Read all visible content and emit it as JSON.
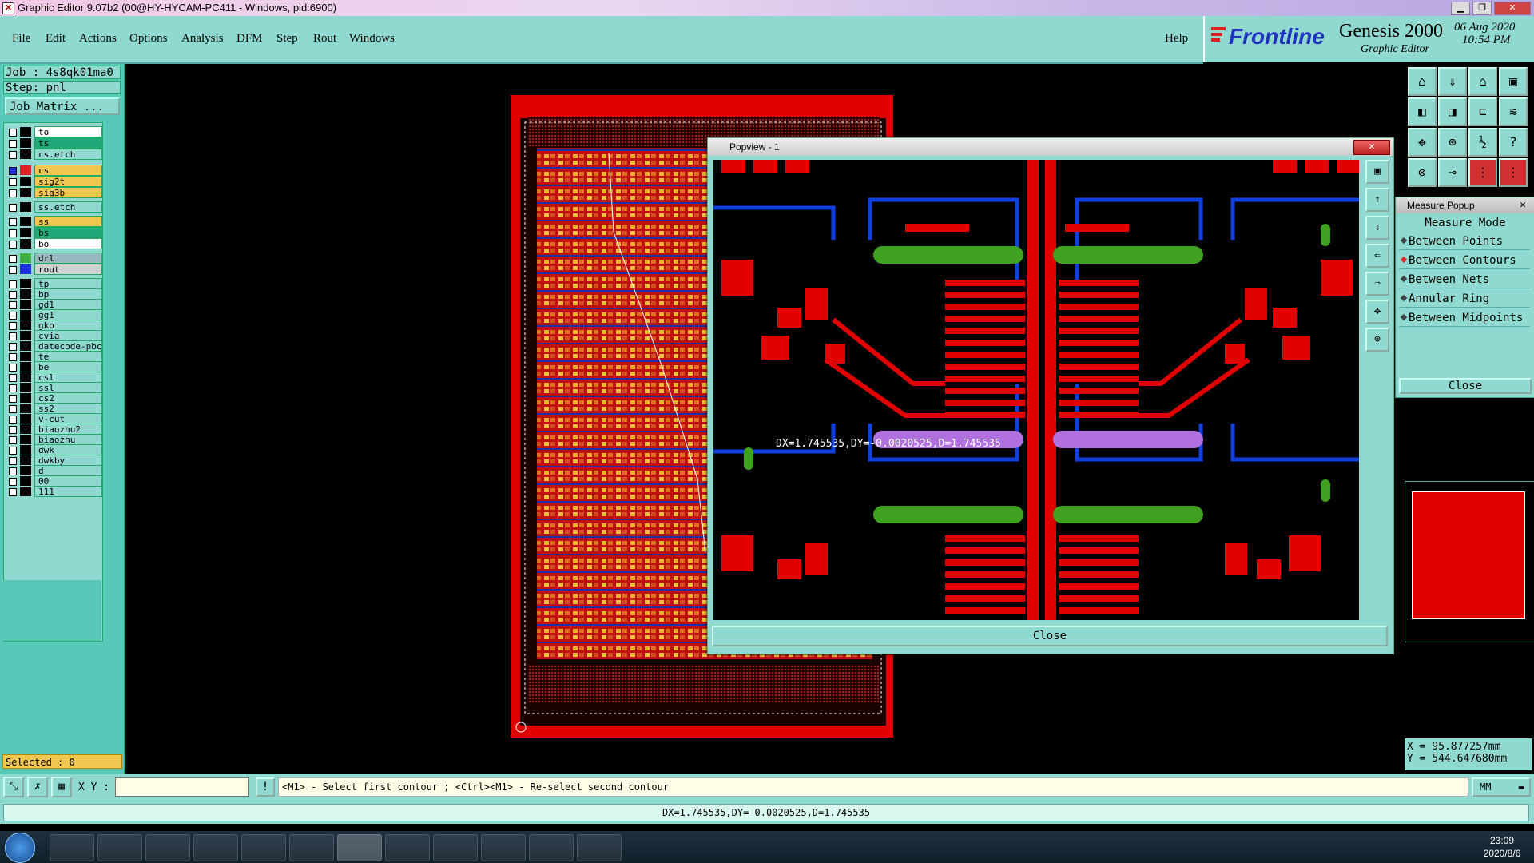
{
  "window": {
    "title": "Graphic Editor 9.07b2 (00@HY-HYCAM-PC411 - Windows, pid:6900)"
  },
  "menu": {
    "items": [
      "File",
      "Edit",
      "Actions",
      "Options",
      "Analysis",
      "DFM",
      "Step",
      "Rout",
      "Windows"
    ],
    "help": "Help"
  },
  "brand": {
    "logo": "Frontline",
    "product": "Genesis 2000",
    "subtitle": "Graphic Editor",
    "date": "06 Aug 2020",
    "time": "10:54 PM",
    "logo_color": "#2030c0"
  },
  "job": {
    "job_label": "Job : 4s8qk01ma0",
    "step_label": "Step: pnl",
    "matrix_button": "Job Matrix ..."
  },
  "layers": [
    {
      "name": "to",
      "color": "#ffffff",
      "swatch": "#000000"
    },
    {
      "name": "ts",
      "color": "#20a878",
      "swatch": "#000000"
    },
    {
      "name": "cs.etch",
      "color": "#8fd9d0",
      "swatch": "#000000"
    },
    {
      "name": "cs",
      "color": "#f0c850",
      "swatch": "#e02020",
      "active": true
    },
    {
      "name": "sig2t",
      "color": "#f0c850",
      "swatch": "#000000"
    },
    {
      "name": "sig3b",
      "color": "#f0c850",
      "swatch": "#000000"
    },
    {
      "name": "ss.etch",
      "color": "#8fd9d0",
      "swatch": "#000000"
    },
    {
      "name": "ss",
      "color": "#f0c850",
      "swatch": "#000000"
    },
    {
      "name": "bs",
      "color": "#20a878",
      "swatch": "#000000"
    },
    {
      "name": "bo",
      "color": "#ffffff",
      "swatch": "#000000"
    },
    {
      "name": "drl",
      "color": "#9ab8c0",
      "swatch": "#40b040"
    },
    {
      "name": "rout",
      "color": "#d0d0d0",
      "swatch": "#2030e0"
    },
    {
      "name": "tp",
      "color": "#8fd9d0",
      "swatch": "#000000"
    },
    {
      "name": "bp",
      "color": "#8fd9d0",
      "swatch": "#000000"
    },
    {
      "name": "gd1",
      "color": "#8fd9d0",
      "swatch": "#000000"
    },
    {
      "name": "gg1",
      "color": "#8fd9d0",
      "swatch": "#000000"
    },
    {
      "name": "gko",
      "color": "#8fd9d0",
      "swatch": "#000000"
    },
    {
      "name": "cvia",
      "color": "#8fd9d0",
      "swatch": "#000000"
    },
    {
      "name": "datecode-pbc",
      "color": "#8fd9d0",
      "swatch": "#000000"
    },
    {
      "name": "te",
      "color": "#8fd9d0",
      "swatch": "#000000"
    },
    {
      "name": "be",
      "color": "#8fd9d0",
      "swatch": "#000000"
    },
    {
      "name": "csl",
      "color": "#8fd9d0",
      "swatch": "#000000"
    },
    {
      "name": "ssl",
      "color": "#8fd9d0",
      "swatch": "#000000"
    },
    {
      "name": "cs2",
      "color": "#8fd9d0",
      "swatch": "#000000"
    },
    {
      "name": "ss2",
      "color": "#8fd9d0",
      "swatch": "#000000"
    },
    {
      "name": "v-cut",
      "color": "#8fd9d0",
      "swatch": "#000000"
    },
    {
      "name": "biaozhu2",
      "color": "#8fd9d0",
      "swatch": "#000000"
    },
    {
      "name": "biaozhu",
      "color": "#8fd9d0",
      "swatch": "#000000"
    },
    {
      "name": "dwk",
      "color": "#8fd9d0",
      "swatch": "#000000"
    },
    {
      "name": "dwkby",
      "color": "#8fd9d0",
      "swatch": "#000000"
    },
    {
      "name": "d",
      "color": "#8fd9d0",
      "swatch": "#000000"
    },
    {
      "name": "00",
      "color": "#8fd9d0",
      "swatch": "#000000"
    },
    {
      "name": "111",
      "color": "#8fd9d0",
      "swatch": "#000000"
    }
  ],
  "selected": "Selected : 0",
  "popview": {
    "title": "Popview - 1",
    "measurement": "DX=1.745535,DY=-0.0020525,D=1.745535",
    "close": "Close"
  },
  "measure_popup": {
    "title": "Measure Popup",
    "mode_label": "Measure Mode",
    "options": [
      "Between Points",
      "Between Contours",
      "Between Nets",
      "Annular Ring",
      "Between Midpoints"
    ],
    "selected_index": 1,
    "close": "Close"
  },
  "coords": {
    "x": "X = 95.877257mm",
    "y": "Y = 544.647680mm"
  },
  "command": {
    "xy_label": "X Y :",
    "xy_value": "",
    "prompt": "<M1> - Select first contour ; <Ctrl><M1> - Re-select second contour",
    "units": "MM",
    "status": "DX=1.745535,DY=-0.0020525,D=1.745535"
  },
  "taskbar": {
    "time": "23:09",
    "date": "2020/8/6"
  },
  "colors": {
    "panel": "#8fd9d0",
    "panel_dark": "#58c8b8",
    "copper": "#e00000",
    "trace_blue": "#1040e0",
    "pad_green": "#40a020",
    "measure_purple": "#b070e0"
  }
}
